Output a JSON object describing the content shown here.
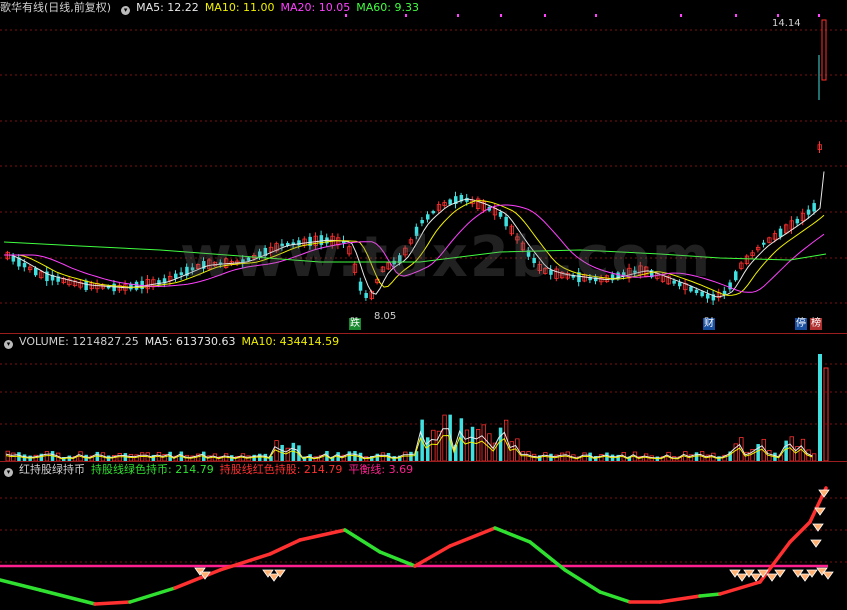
{
  "price_panel": {
    "stock_name": "歌华有线(日线,前复权)",
    "ma_labels": [
      {
        "text": "MA5: 12.22",
        "color": "#e8e8e8"
      },
      {
        "text": "MA10: 11.00",
        "color": "#f0f000"
      },
      {
        "text": "MA20: 10.05",
        "color": "#ff40ff"
      },
      {
        "text": "MA60: 9.33",
        "color": "#40ff40"
      }
    ],
    "high_label": "14.14",
    "low_label": "8.05",
    "tags": {
      "die": "跌",
      "cai": "财",
      "ting": "停",
      "bang": "榜"
    },
    "watermark": "www.tdx2b.com"
  },
  "volume_panel": {
    "title": "VOLUME: 1214827.25",
    "ma5": "MA5: 613730.63",
    "ma10": "MA10: 434414.59"
  },
  "indicator_panel": {
    "title": "红持股绿持币",
    "green_line": "持股线绿色持币: 214.79",
    "red_line": "持股线红色持股: 214.79",
    "balance_line": "平衡线: 3.69"
  },
  "colors": {
    "up": "#ff3030",
    "down": "#40e0e0",
    "grid": "#7a1010",
    "pink": "#ff2090",
    "green": "#30e030"
  }
}
